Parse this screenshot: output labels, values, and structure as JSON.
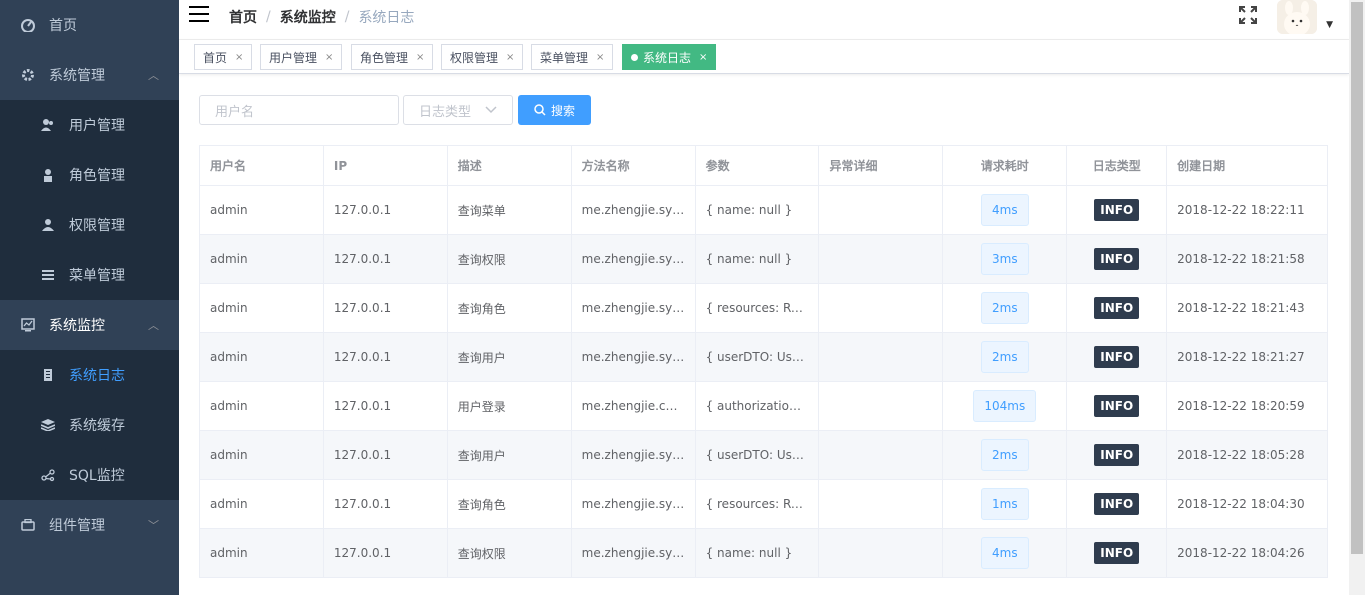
{
  "sidebar": {
    "home": "首页",
    "system_management": "系统管理",
    "user_management": "用户管理",
    "role_management": "角色管理",
    "permission_management": "权限管理",
    "menu_management": "菜单管理",
    "system_monitor": "系统监控",
    "system_log": "系统日志",
    "system_cache": "系统缓存",
    "sql_monitor": "SQL监控",
    "component_management": "组件管理"
  },
  "breadcrumb": [
    "首页",
    "系统监控",
    "系统日志"
  ],
  "breadcrumb_sep": "/",
  "tags": [
    {
      "label": "首页"
    },
    {
      "label": "用户管理"
    },
    {
      "label": "角色管理"
    },
    {
      "label": "权限管理"
    },
    {
      "label": "菜单管理"
    },
    {
      "label": "系统日志"
    }
  ],
  "tag_close": "×",
  "filter": {
    "username_placeholder": "用户名",
    "log_type_placeholder": "日志类型",
    "search_label": "搜索"
  },
  "table": {
    "headers": [
      "用户名",
      "IP",
      "描述",
      "方法名称",
      "参数",
      "异常详细",
      "请求耗时",
      "日志类型",
      "创建日期"
    ],
    "rows": [
      [
        "admin",
        "127.0.0.1",
        "查询菜单",
        "me.zhengjie.system.rest.MenuController.getMenus()",
        "{ name: null }",
        "",
        "4ms",
        "INFO",
        "2018-12-22 18:22:11"
      ],
      [
        "admin",
        "127.0.0.1",
        "查询权限",
        "me.zhengjie.system.rest.PermissionController.getPermissions()",
        "{ name: null }",
        "",
        "3ms",
        "INFO",
        "2018-12-22 18:21:58"
      ],
      [
        "admin",
        "127.0.0.1",
        "查询角色",
        "me.zhengjie.system.rest.RoleController.getRoles()",
        "{ resources: RoleDTO }",
        "",
        "2ms",
        "INFO",
        "2018-12-22 18:21:43"
      ],
      [
        "admin",
        "127.0.0.1",
        "查询用户",
        "me.zhengjie.system.rest.UserController.getUsers()",
        "{ userDTO: UserDTO }",
        "",
        "2ms",
        "INFO",
        "2018-12-22 18:21:27"
      ],
      [
        "admin",
        "127.0.0.1",
        "用户登录",
        "me.zhengjie.core.rest.AuthenticationController.login()",
        "{ authorizationUser: AuthorizationUser }",
        "",
        "104ms",
        "INFO",
        "2018-12-22 18:20:59"
      ],
      [
        "admin",
        "127.0.0.1",
        "查询用户",
        "me.zhengjie.system.rest.UserController.getUsers()",
        "{ userDTO: UserDTO }",
        "",
        "2ms",
        "INFO",
        "2018-12-22 18:05:28"
      ],
      [
        "admin",
        "127.0.0.1",
        "查询角色",
        "me.zhengjie.system.rest.RoleController.getRoles()",
        "{ resources: RoleDTO }",
        "",
        "1ms",
        "INFO",
        "2018-12-22 18:04:30"
      ],
      [
        "admin",
        "127.0.0.1",
        "查询权限",
        "me.zhengjie.system.rest.PermissionController.getPermissions()",
        "{ name: null }",
        "",
        "4ms",
        "INFO",
        "2018-12-22 18:04:26"
      ]
    ]
  },
  "colors": {
    "sidebar_bg": "#304156",
    "submenu_bg": "#1f2d3d",
    "active_menu": "#409eff",
    "active_tag": "#42b983",
    "primary": "#409eff",
    "info_tag": "#2f3c4e"
  },
  "icons": [
    "dashboard-icon",
    "gear-icon",
    "user-icon",
    "role-icon",
    "permission-icon",
    "list-icon",
    "monitor-icon",
    "log-icon",
    "cache-icon",
    "sql-icon",
    "component-icon",
    "hamburger-icon",
    "fullscreen-icon",
    "search-icon",
    "chevron-down-icon"
  ]
}
